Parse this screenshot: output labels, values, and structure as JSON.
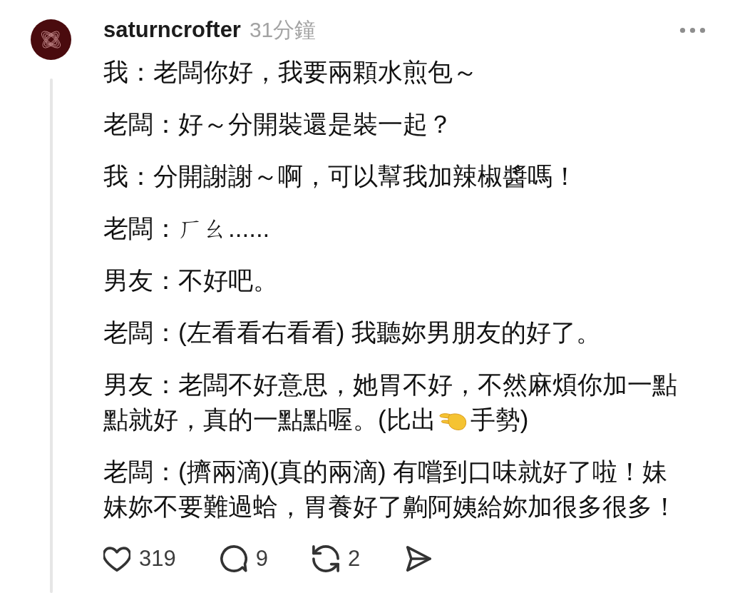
{
  "post": {
    "author": "saturncrofter",
    "time": "31分鐘",
    "paragraphs": [
      {
        "kind": "text",
        "text": "我：老闆你好，我要兩顆水煎包～"
      },
      {
        "kind": "text",
        "text": "老闆：好～分開裝還是裝一起？"
      },
      {
        "kind": "text",
        "text": "我：分開謝謝～啊，可以幫我加辣椒醬嗎！"
      },
      {
        "kind": "text",
        "text": "老闆：ㄏㄠ......"
      },
      {
        "kind": "text",
        "text": "男友：不好吧。"
      },
      {
        "kind": "text",
        "text": "老闆：(左看看右看看) 我聽妳男朋友的好了。"
      },
      {
        "kind": "gesture",
        "before": "男友：老闆不好意思，她胃不好，不然麻煩你加一點點就好，真的一點點喔。(比出",
        "after": "手勢)"
      },
      {
        "kind": "text",
        "text": "老闆：(擠兩滴)(真的兩滴) 有嚐到口味就好了啦！妹妹妳不要難過蛤，胃養好了齁阿姨給妳加很多很多！"
      }
    ],
    "actions": [
      {
        "kind": "like",
        "count": "319"
      },
      {
        "kind": "reply",
        "count": "9"
      },
      {
        "kind": "repost",
        "count": "2"
      },
      {
        "kind": "share"
      }
    ]
  }
}
